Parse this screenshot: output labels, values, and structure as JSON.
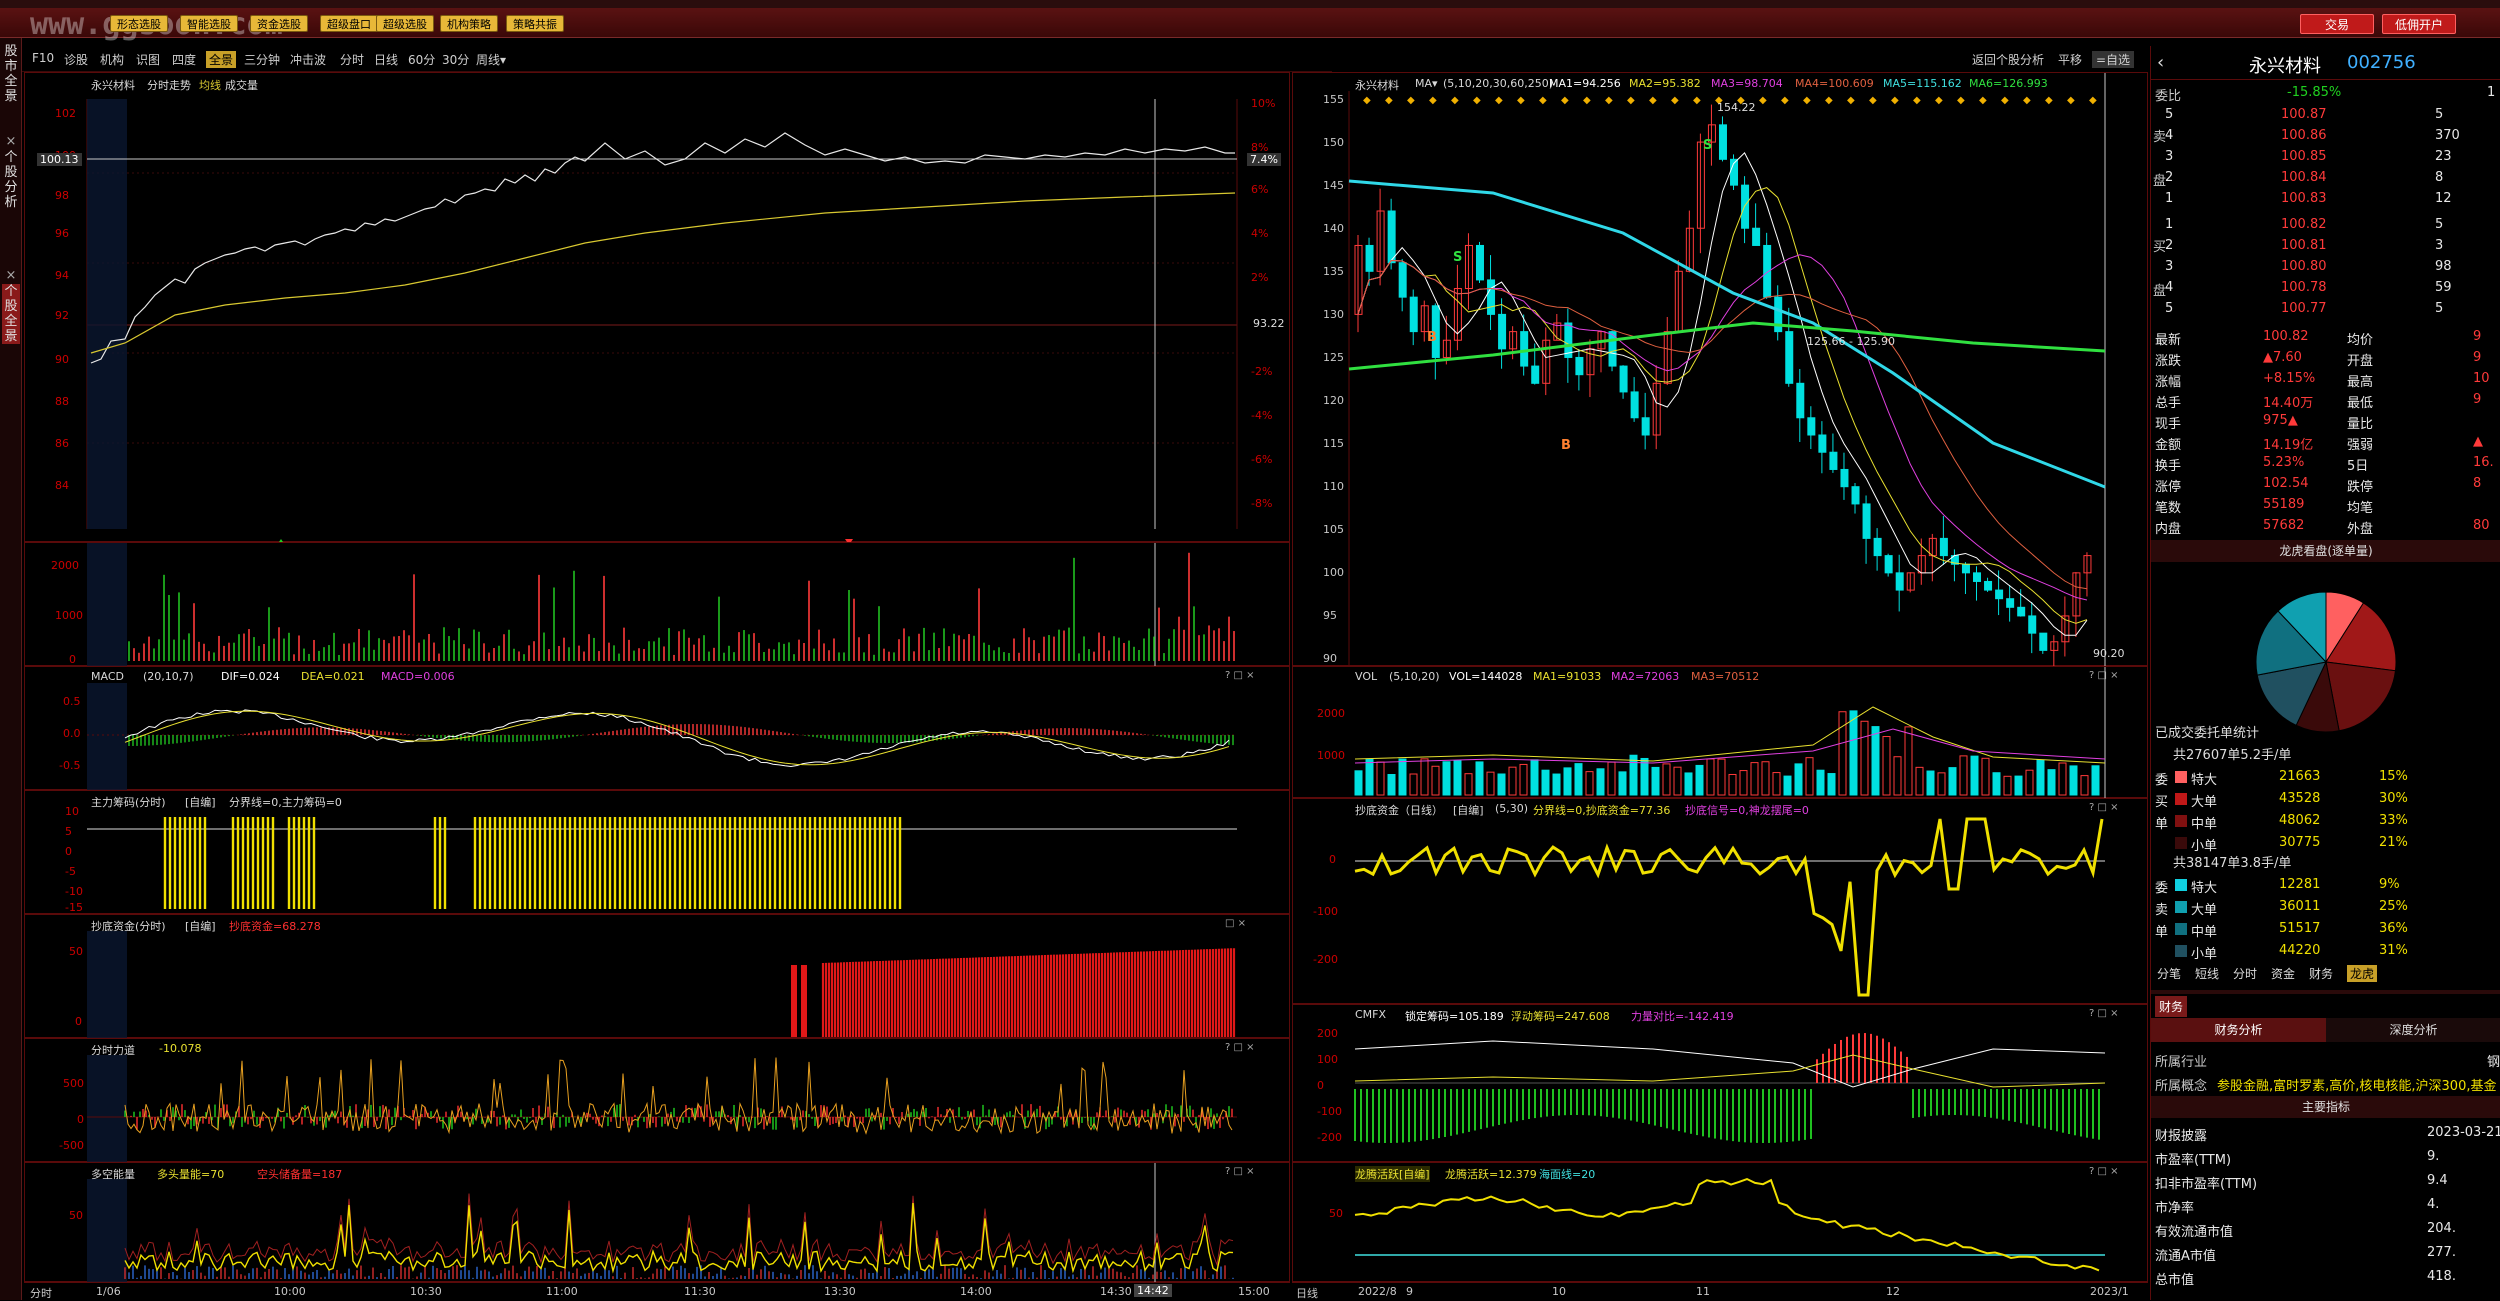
{
  "window": {
    "watermark": "www.ggsoon.com"
  },
  "toolbar": {
    "btns": [
      "形态选股",
      "智能选股",
      "资金选股",
      "超级盘口",
      "超级选股",
      "机构策略",
      "策略共振"
    ],
    "trade": "交易",
    "open_account": "低佣开户"
  },
  "sidetabs": [
    "股市全景",
    "个股分析",
    "个股全景"
  ],
  "nav": {
    "items": [
      "F10",
      "诊股",
      "机构",
      "识图",
      "四度",
      "全景",
      "三分钟",
      "冲击波",
      "分时",
      "日线",
      "60分",
      "30分",
      "周线▾"
    ],
    "right": [
      "返回个股分析",
      "平移",
      "=自选"
    ]
  },
  "intraday": {
    "title": "永兴材料",
    "sub": "分时走势",
    "avg": "均线",
    "volume": "成交量",
    "price_labels": [
      "102",
      "100",
      "98",
      "96",
      "94",
      "92",
      "90",
      "88",
      "86",
      "84"
    ],
    "pct_labels": [
      "10%",
      "8%",
      "6%",
      "4%",
      "2%",
      "-2%",
      "-4%",
      "-6%",
      "-8%"
    ],
    "current": "100.13",
    "pct_current": "7.4%",
    "base": "93.22",
    "vol_labels": [
      "2000",
      "1000",
      "0"
    ],
    "time_labels": [
      "分时",
      "1/06",
      "10:00",
      "10:30",
      "11:00",
      "11:30",
      "13:30",
      "14:00",
      "14:30",
      "14:42",
      "15:00"
    ],
    "macd": {
      "name": "MACD",
      "params": "(20,10,7)",
      "dif": "DIF=0.024",
      "dea": "DEA=0.021",
      "macd": "MACD=0.006",
      "labels": [
        "0.5",
        "0.0",
        "-0.5"
      ]
    },
    "zl": {
      "name": "主力筹码(分时)",
      "tag": "[自编]",
      "text": "分界线=0,主力筹码=0",
      "labels": [
        "10",
        "5",
        "0",
        "-5",
        "-10",
        "-15"
      ]
    },
    "cd": {
      "name": "抄底资金(分时)",
      "tag": "[自编]",
      "text": "抄底资金=68.278",
      "labels": [
        "50",
        "0"
      ]
    },
    "fl": {
      "name": "分时力道",
      "text": "-10.078",
      "labels": [
        "500",
        "0",
        "-500"
      ]
    },
    "dk": {
      "name": "多空能量",
      "a": "多头量能=70",
      "b": "空头储备量=187",
      "labels": [
        "50"
      ]
    }
  },
  "daily": {
    "title": "永兴材料",
    "ma": "MA▾",
    "params": "(5,10,20,30,60,250)",
    "ma_vals": [
      "MA1=94.256",
      "MA2=95.382",
      "MA3=98.704",
      "MA4=100.609",
      "MA5=115.162",
      "MA6=126.993"
    ],
    "price_labels": [
      "155",
      "150",
      "145",
      "140",
      "135",
      "130",
      "125",
      "120",
      "115",
      "110",
      "105",
      "100",
      "95",
      "90"
    ],
    "high": "154.22",
    "range": "125.66 - 125.90",
    "low": "90.20",
    "vol": {
      "name": "VOL",
      "params": "(5,10,20)",
      "v": "VOL=144028",
      "ma1": "MA1=91033",
      "ma2": "MA2=72063",
      "ma3": "MA3=70512",
      "labels": [
        "2000",
        "1000"
      ]
    },
    "cd": {
      "name": "抄底资金（日线）",
      "tag": "[自编]",
      "params": "(5,30)",
      "text": "分界线=0,抄底资金=77.36",
      "sig": "抄底信号=0,神龙摆尾=0",
      "labels": [
        "0",
        "-100",
        "-200"
      ]
    },
    "cmfx": {
      "name": "CMFX",
      "a": "锁定筹码=105.189",
      "b": "浮动筹码=247.608",
      "c": "力量对比=-142.419",
      "labels": [
        "200",
        "100",
        "0",
        "-100",
        "-200"
      ]
    },
    "lt": {
      "name": "龙腾活跃[自编]",
      "a": "龙腾活跃=12.379",
      "b": "海面线=20",
      "labels": [
        "50"
      ]
    },
    "time_labels": [
      "日线",
      "2022/8",
      "9",
      "10",
      "11",
      "12",
      "2023/1"
    ]
  },
  "quote": {
    "name": "永兴材料",
    "code": "002756",
    "weibi_label": "委比",
    "weibi": "-15.85%",
    "weicha": "1",
    "asks": [
      [
        "5",
        "100.87",
        "5"
      ],
      [
        "4",
        "100.86",
        "370"
      ],
      [
        "3",
        "100.85",
        "23"
      ],
      [
        "2",
        "100.84",
        "8"
      ],
      [
        "1",
        "100.83",
        "12"
      ]
    ],
    "bids": [
      [
        "1",
        "100.82",
        "5"
      ],
      [
        "2",
        "100.81",
        "3"
      ],
      [
        "3",
        "100.80",
        "98"
      ],
      [
        "4",
        "100.78",
        "59"
      ],
      [
        "5",
        "100.77",
        "5"
      ]
    ],
    "side_sell": "卖",
    "side_buy": "买",
    "side_pan": "盘",
    "stats": [
      [
        "最新",
        "100.82",
        "均价",
        "9"
      ],
      [
        "涨跌",
        "▲7.60",
        "开盘",
        "9"
      ],
      [
        "涨幅",
        "+8.15%",
        "最高",
        "10"
      ],
      [
        "总手",
        "14.40万",
        "最低",
        "9"
      ],
      [
        "现手",
        "975▲",
        "量比",
        ""
      ],
      [
        "金额",
        "14.19亿",
        "强弱",
        "▲"
      ],
      [
        "换手",
        "5.23%",
        "5日",
        "16."
      ],
      [
        "涨停",
        "102.54",
        "跌停",
        "8"
      ],
      [
        "笔数",
        "55189",
        "均笔",
        ""
      ],
      [
        "内盘",
        "57682",
        "外盘",
        "80"
      ]
    ],
    "pie_title": "龙虎看盘(逐单量)",
    "order_title": "已成交委托单统计",
    "buy_head": "共27607单5.2手/单",
    "buy_rows": [
      [
        "委",
        "特大",
        "21663",
        "15%"
      ],
      [
        "买",
        "大单",
        "43528",
        "30%"
      ],
      [
        "单",
        "中单",
        "48062",
        "33%"
      ],
      [
        "",
        "小单",
        "30775",
        "21%"
      ]
    ],
    "sell_head": "共38147单3.8手/单",
    "sell_rows": [
      [
        "委",
        "特大",
        "12281",
        "9%"
      ],
      [
        "卖",
        "大单",
        "36011",
        "25%"
      ],
      [
        "单",
        "中单",
        "51517",
        "36%"
      ],
      [
        "",
        "小单",
        "44220",
        "31%"
      ]
    ],
    "tabs": [
      "分笔",
      "短线",
      "分时",
      "资金",
      "财务",
      "龙虎"
    ],
    "fin_tab": "财务",
    "fin_heads": [
      "财务分析",
      "深度分析"
    ],
    "industry_label": "所属行业",
    "industry": "钢",
    "concept_label": "所属概念",
    "concept": "参股金融,富时罗素,高价,核电核能,沪深300,基金",
    "main_idx": "主要指标",
    "fin_rows": [
      [
        "财报披露",
        "2023-03-21"
      ],
      [
        "市盈率(TTM)",
        "9."
      ],
      [
        "扣非市盈率(TTM)",
        "9.4"
      ],
      [
        "市净率",
        "4."
      ],
      [
        "有效流通市值",
        "204."
      ],
      [
        "流通A市值",
        "277."
      ],
      [
        "总市值",
        "418."
      ]
    ]
  },
  "colors": {
    "up": "#ff3a3a",
    "down": "#00e0e0",
    "avg": "#d8c830",
    "price": "#e8e8e8",
    "yellow": "#f0e000"
  }
}
